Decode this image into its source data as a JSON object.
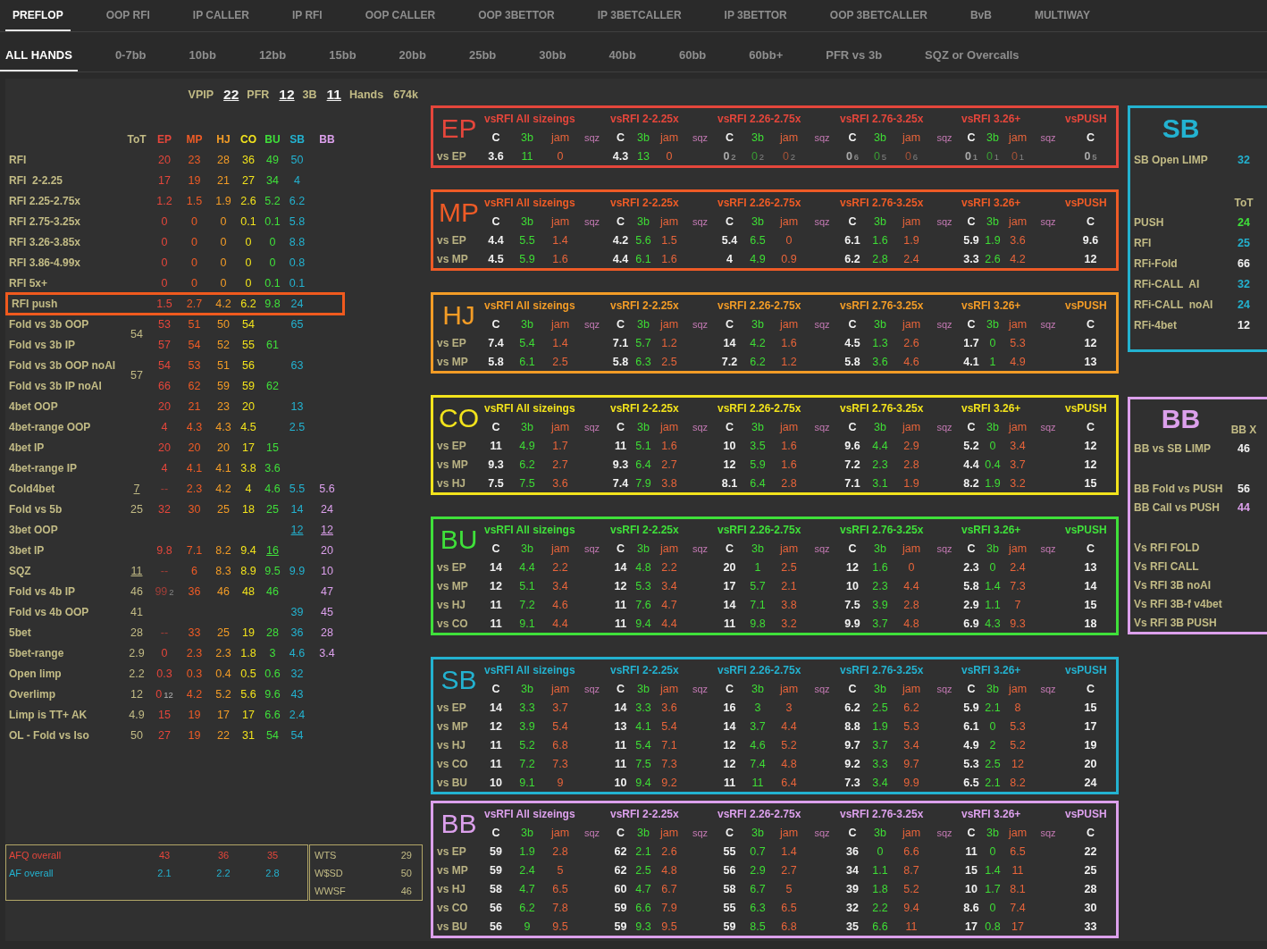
{
  "tabs": [
    {
      "label": "PREFLOP",
      "selected": true
    },
    {
      "label": "OOP RFI",
      "selected": false
    },
    {
      "label": "IP CALLER",
      "selected": false
    },
    {
      "label": "IP RFI",
      "selected": false
    },
    {
      "label": "OOP CALLER",
      "selected": false
    },
    {
      "label": "OOP 3BETTOR",
      "selected": false
    },
    {
      "label": "IP 3BETCALLER",
      "selected": false
    },
    {
      "label": "IP 3BETTOR",
      "selected": false
    },
    {
      "label": "OOP 3BETCALLER",
      "selected": false
    },
    {
      "label": "BvB",
      "selected": false
    },
    {
      "label": "MULTIWAY",
      "selected": false
    }
  ],
  "subtabs": [
    {
      "label": "ALL HANDS",
      "selected": true
    },
    {
      "label": "0-7bb",
      "selected": false
    },
    {
      "label": "10bb",
      "selected": false
    },
    {
      "label": "12bb",
      "selected": false
    },
    {
      "label": "15bb",
      "selected": false
    },
    {
      "label": "20bb",
      "selected": false
    },
    {
      "label": "25bb",
      "selected": false
    },
    {
      "label": "30bb",
      "selected": false
    },
    {
      "label": "40bb",
      "selected": false
    },
    {
      "label": "60bb",
      "selected": false
    },
    {
      "label": "60bb+",
      "selected": false
    },
    {
      "label": "PFR vs 3b",
      "selected": false
    },
    {
      "label": "SQZ or Overcalls",
      "selected": false
    }
  ],
  "summary": [
    {
      "label": "VPIP",
      "value": "22",
      "underlined": true
    },
    {
      "label": "PFR",
      "value": "12",
      "underlined": true
    },
    {
      "label": "3B",
      "value": "11",
      "underlined": true
    },
    {
      "label": "Hands",
      "value": "674k",
      "underlined": false
    }
  ],
  "position_table": {
    "columns": [
      {
        "label": "ToT",
        "color": "#c2bb85"
      },
      {
        "label": "EP",
        "color": "#e5463b"
      },
      {
        "label": "MP",
        "color": "#ee5b26"
      },
      {
        "label": "HJ",
        "color": "#f39c26"
      },
      {
        "label": "CO",
        "color": "#f2e31c"
      },
      {
        "label": "BU",
        "color": "#3fe03a"
      },
      {
        "label": "SB",
        "color": "#23b2d0"
      },
      {
        "label": "BB",
        "color": "#dca0ec"
      }
    ],
    "rows": [
      {
        "label": "RFI",
        "highlighted": false,
        "cells": [
          null,
          "20",
          "23",
          "28",
          "36",
          "49",
          "50",
          null
        ]
      },
      {
        "label": "RFI  2-2.25",
        "highlighted": false,
        "cells": [
          null,
          "17",
          "19",
          "21",
          "27",
          "34",
          "4",
          null
        ]
      },
      {
        "label": "RFI 2.25-2.75x",
        "highlighted": false,
        "cells": [
          null,
          "1.2",
          "1.5",
          "1.9",
          "2.6",
          "5.2",
          "6.2",
          null
        ]
      },
      {
        "label": "RFI 2.75-3.25x",
        "highlighted": false,
        "cells": [
          null,
          "0",
          "0",
          "0",
          "0.1",
          "0.1",
          "5.8",
          null
        ]
      },
      {
        "label": "RFI 3.26-3.85x",
        "highlighted": false,
        "cells": [
          null,
          "0",
          "0",
          "0",
          "0",
          "0",
          "8.8",
          null
        ]
      },
      {
        "label": "RFI 3.86-4.99x",
        "highlighted": false,
        "cells": [
          null,
          "0",
          "0",
          "0",
          "0",
          "0",
          "0.8",
          null
        ]
      },
      {
        "label": "RFI 5x+",
        "highlighted": false,
        "cells": [
          null,
          "0",
          "0",
          "0",
          "0",
          "0.1",
          "0.1",
          null
        ]
      },
      {
        "label": "RFI push",
        "highlighted": true,
        "cells": [
          null,
          "1.5",
          "2.7",
          "4.2",
          "6.2",
          "9.8",
          "24",
          null
        ]
      },
      {
        "label": "Fold vs 3b OOP",
        "highlighted": false,
        "cells": [
          {
            "value": "54",
            "spans_next_row": true
          },
          "53",
          "51",
          "50",
          "54",
          null,
          "65",
          null
        ]
      },
      {
        "label": "Fold vs 3b IP",
        "highlighted": false,
        "cells": [
          null,
          "57",
          "54",
          "52",
          "55",
          "61",
          null,
          null
        ]
      },
      {
        "label": "Fold vs 3b OOP noAI",
        "highlighted": false,
        "cells": [
          {
            "value": "57",
            "spans_next_row": true
          },
          "54",
          "53",
          "51",
          "56",
          null,
          "63",
          null
        ]
      },
      {
        "label": "Fold vs 3b IP noAI",
        "highlighted": false,
        "cells": [
          null,
          "66",
          "62",
          "59",
          "59",
          "62",
          null,
          null
        ]
      },
      {
        "label": "4bet OOP",
        "highlighted": false,
        "cells": [
          null,
          "20",
          "21",
          "23",
          "20",
          null,
          "13",
          null
        ]
      },
      {
        "label": "4bet-range OOP",
        "highlighted": false,
        "cells": [
          null,
          "4",
          "4.3",
          "4.3",
          "4.5",
          null,
          "2.5",
          null
        ]
      },
      {
        "label": "4bet IP",
        "highlighted": false,
        "cells": [
          null,
          "20",
          "20",
          "20",
          "17",
          "15",
          null,
          null
        ]
      },
      {
        "label": "4bet-range IP",
        "highlighted": false,
        "cells": [
          null,
          "4",
          "4.1",
          "4.1",
          "3.8",
          "3.6",
          null,
          null
        ]
      },
      {
        "label": "Cold4bet",
        "highlighted": false,
        "cells": [
          {
            "value": "7",
            "underlined": true
          },
          {
            "value": "--",
            "dim": true
          },
          "2.3",
          "4.2",
          "4",
          "4.6",
          "5.5",
          "5.6"
        ]
      },
      {
        "label": "Fold vs 5b",
        "highlighted": false,
        "cells": [
          "25",
          "32",
          "30",
          "25",
          "18",
          "25",
          "14",
          "24"
        ]
      },
      {
        "label": "3bet OOP",
        "highlighted": false,
        "cells": [
          null,
          null,
          null,
          null,
          null,
          null,
          {
            "value": "12",
            "underlined": true
          },
          {
            "value": "12",
            "underlined": true
          }
        ]
      },
      {
        "label": "3bet IP",
        "highlighted": false,
        "cells": [
          null,
          "9.8",
          "7.1",
          "8.2",
          "9.4",
          {
            "value": "16",
            "underlined": true
          },
          null,
          "20"
        ]
      },
      {
        "label": "SQZ",
        "highlighted": false,
        "cells": [
          {
            "value": "11",
            "underlined": true
          },
          {
            "value": "--",
            "dim": true
          },
          "6",
          "8.3",
          "8.9",
          "9.5",
          "9.9",
          "10"
        ]
      },
      {
        "label": "Fold vs 4b IP",
        "highlighted": false,
        "cells": [
          "46",
          {
            "value": "99",
            "sample": "2",
            "dim": true
          },
          "36",
          "46",
          "48",
          "46",
          null,
          "47"
        ]
      },
      {
        "label": "Fold vs 4b OOP",
        "highlighted": false,
        "cells": [
          "41",
          null,
          null,
          null,
          null,
          null,
          "39",
          "45"
        ]
      },
      {
        "label": "5bet",
        "highlighted": false,
        "cells": [
          "28",
          {
            "value": "--",
            "dim": true
          },
          "33",
          "25",
          "19",
          "28",
          "36",
          "28"
        ]
      },
      {
        "label": "5bet-range",
        "highlighted": false,
        "cells": [
          "2.9",
          "0",
          "2.3",
          "2.3",
          "1.8",
          "3",
          "4.6",
          "3.4"
        ]
      },
      {
        "label": "Open limp",
        "highlighted": false,
        "cells": [
          "2.2",
          "0.3",
          "0.3",
          "0.4",
          "0.5",
          "0.6",
          "32",
          null
        ]
      },
      {
        "label": "Overlimp",
        "highlighted": false,
        "cells": [
          "12",
          {
            "value": "0",
            "sample": "12"
          },
          "4.2",
          "5.2",
          "5.6",
          "9.6",
          "43",
          null
        ]
      },
      {
        "label": "Limp is TT+ AK",
        "highlighted": false,
        "cells": [
          "4.9",
          "15",
          "19",
          "17",
          "17",
          "6.6",
          "2.4",
          null
        ]
      },
      {
        "label": "OL - Fold vs Iso",
        "highlighted": false,
        "cells": [
          "50",
          "27",
          "19",
          "22",
          "31",
          "54",
          "54",
          null
        ]
      }
    ]
  },
  "aggression": [
    {
      "label": "AFQ overall",
      "color": "#e5463b",
      "values": [
        "43",
        "36",
        "35"
      ]
    },
    {
      "label": "AF overall",
      "color": "#23b2d0",
      "values": [
        "2.1",
        "2.2",
        "2.8"
      ]
    }
  ],
  "showdown": [
    {
      "label": "WTS",
      "value": "29"
    },
    {
      "label": "W$SD",
      "value": "50"
    },
    {
      "label": "WWSF",
      "value": "46"
    }
  ],
  "position_panels": [
    {
      "title": "EP",
      "color": "#e5463b",
      "groups": [
        {
          "heading": "vsRFI All sizeings",
          "columns": [
            "C",
            "3b",
            "jam",
            "sqz"
          ]
        },
        {
          "heading": "vsRFI 2-2.25x",
          "columns": [
            "C",
            "3b",
            "jam",
            "sqz"
          ]
        },
        {
          "heading": "vsRFI 2.26-2.75x",
          "columns": [
            "C",
            "3b",
            "jam",
            "sqz"
          ]
        },
        {
          "heading": "vsRFI 2.76-3.25x",
          "columns": [
            "C",
            "3b",
            "jam",
            "sqz"
          ]
        },
        {
          "heading": "vsRFI 3.26+",
          "columns": [
            "C",
            "3b",
            "jam",
            "sqz"
          ]
        },
        {
          "heading": "vsPUSH",
          "columns": [
            "C"
          ]
        }
      ],
      "rows": [
        {
          "label": "vs EP",
          "cells": [
            [
              "3.6",
              "11",
              "0"
            ],
            [
              "4.3",
              "13",
              "0"
            ],
            [
              {
                "value": "0",
                "sample": "2",
                "dim": true
              },
              {
                "value": "0",
                "sample": "2",
                "dim": true
              },
              {
                "value": "0",
                "sample": "2",
                "dim": true
              }
            ],
            [
              {
                "value": "0",
                "sample": "6",
                "dim": true
              },
              {
                "value": "0",
                "sample": "5",
                "dim": true
              },
              {
                "value": "0",
                "sample": "6",
                "dim": true
              }
            ],
            [
              {
                "value": "0",
                "sample": "1",
                "dim": true
              },
              {
                "value": "0",
                "sample": "1",
                "dim": true
              },
              {
                "value": "0",
                "sample": "1",
                "dim": true
              }
            ],
            [
              {
                "value": "0",
                "sample": "5",
                "dim": true
              }
            ]
          ]
        }
      ]
    },
    {
      "title": "MP",
      "color": "#ee5b26",
      "groups": [
        {
          "heading": "vsRFI All sizeings",
          "columns": [
            "C",
            "3b",
            "jam",
            "sqz"
          ]
        },
        {
          "heading": "vsRFI 2-2.25x",
          "columns": [
            "C",
            "3b",
            "jam",
            "sqz"
          ]
        },
        {
          "heading": "vsRFI 2.26-2.75x",
          "columns": [
            "C",
            "3b",
            "jam",
            "sqz"
          ]
        },
        {
          "heading": "vsRFI 2.76-3.25x",
          "columns": [
            "C",
            "3b",
            "jam",
            "sqz"
          ]
        },
        {
          "heading": "vsRFI 3.26+",
          "columns": [
            "C",
            "3b",
            "jam",
            "sqz"
          ]
        },
        {
          "heading": "vsPUSH",
          "columns": [
            "C"
          ]
        }
      ],
      "rows": [
        {
          "label": "vs EP",
          "cells": [
            [
              "4.4",
              "5.5",
              "1.4"
            ],
            [
              "4.2",
              "5.6",
              "1.5"
            ],
            [
              "5.4",
              "6.5",
              "0"
            ],
            [
              "6.1",
              "1.6",
              "1.9"
            ],
            [
              "5.9",
              "1.9",
              "3.6"
            ],
            [
              "9.6"
            ]
          ]
        },
        {
          "label": "vs MP",
          "cells": [
            [
              "4.5",
              "5.9",
              "1.6"
            ],
            [
              "4.4",
              "6.1",
              "1.6"
            ],
            [
              "4",
              "4.9",
              "0.9"
            ],
            [
              "6.2",
              "2.8",
              "2.4"
            ],
            [
              "3.3",
              "2.6",
              "4.2"
            ],
            [
              "12"
            ]
          ]
        }
      ]
    },
    {
      "title": "HJ",
      "color": "#f39c26",
      "groups": [
        {
          "heading": "vsRFI All sizeings",
          "columns": [
            "C",
            "3b",
            "jam",
            "sqz"
          ]
        },
        {
          "heading": "vsRFI 2-2.25x",
          "columns": [
            "C",
            "3b",
            "jam",
            "sqz"
          ]
        },
        {
          "heading": "vsRFI 2.26-2.75x",
          "columns": [
            "C",
            "3b",
            "jam",
            "sqz"
          ]
        },
        {
          "heading": "vsRFI 2.76-3.25x",
          "columns": [
            "C",
            "3b",
            "jam",
            "sqz"
          ]
        },
        {
          "heading": "vsRFI 3.26+",
          "columns": [
            "C",
            "3b",
            "jam",
            "sqz"
          ]
        },
        {
          "heading": "vsPUSH",
          "columns": [
            "C"
          ]
        }
      ],
      "rows": [
        {
          "label": "vs EP",
          "cells": [
            [
              "7.4",
              "5.4",
              "1.4"
            ],
            [
              "7.1",
              "5.7",
              "1.2"
            ],
            [
              "14",
              "4.2",
              "1.6"
            ],
            [
              "4.5",
              "1.3",
              "2.6"
            ],
            [
              "1.7",
              "0",
              "5.3"
            ],
            [
              "12"
            ]
          ]
        },
        {
          "label": "vs MP",
          "cells": [
            [
              "5.8",
              "6.1",
              "2.5"
            ],
            [
              "5.8",
              "6.3",
              "2.5"
            ],
            [
              "7.2",
              "6.2",
              "1.2"
            ],
            [
              "5.8",
              "3.6",
              "4.6"
            ],
            [
              "4.1",
              "1",
              "4.9"
            ],
            [
              "13"
            ]
          ]
        }
      ]
    },
    {
      "title": "CO",
      "color": "#f2e31c",
      "groups": [
        {
          "heading": "vsRFI All sizeings",
          "columns": [
            "C",
            "3b",
            "jam",
            "sqz"
          ]
        },
        {
          "heading": "vsRFI 2-2.25x",
          "columns": [
            "C",
            "3b",
            "jam",
            "sqz"
          ]
        },
        {
          "heading": "vsRFI 2.26-2.75x",
          "columns": [
            "C",
            "3b",
            "jam",
            "sqz"
          ]
        },
        {
          "heading": "vsRFI 2.76-3.25x",
          "columns": [
            "C",
            "3b",
            "jam",
            "sqz"
          ]
        },
        {
          "heading": "vsRFI 3.26+",
          "columns": [
            "C",
            "3b",
            "jam",
            "sqz"
          ]
        },
        {
          "heading": "vsPUSH",
          "columns": [
            "C"
          ]
        }
      ],
      "rows": [
        {
          "label": "vs EP",
          "cells": [
            [
              "11",
              "4.9",
              "1.7"
            ],
            [
              "11",
              "5.1",
              "1.6"
            ],
            [
              "10",
              "3.5",
              "1.6"
            ],
            [
              "9.6",
              "4.4",
              "2.9"
            ],
            [
              "5.2",
              "0",
              "3.4"
            ],
            [
              "12"
            ]
          ]
        },
        {
          "label": "vs MP",
          "cells": [
            [
              "9.3",
              "6.2",
              "2.7"
            ],
            [
              "9.3",
              "6.4",
              "2.7"
            ],
            [
              "12",
              "5.9",
              "1.6"
            ],
            [
              "7.2",
              "2.3",
              "2.8"
            ],
            [
              "4.4",
              "0.4",
              "3.7"
            ],
            [
              "12"
            ]
          ]
        },
        {
          "label": "vs HJ",
          "cells": [
            [
              "7.5",
              "7.5",
              "3.6"
            ],
            [
              "7.4",
              "7.9",
              "3.8"
            ],
            [
              "8.1",
              "6.4",
              "2.8"
            ],
            [
              "7.1",
              "3.1",
              "1.9"
            ],
            [
              "8.2",
              "1.9",
              "3.2"
            ],
            [
              "15"
            ]
          ]
        }
      ]
    },
    {
      "title": "BU",
      "color": "#3fe03a",
      "groups": [
        {
          "heading": "vsRFI All sizeings",
          "columns": [
            "C",
            "3b",
            "jam",
            "sqz"
          ]
        },
        {
          "heading": "vsRFI 2-2.25x",
          "columns": [
            "C",
            "3b",
            "jam",
            "sqz"
          ]
        },
        {
          "heading": "vsRFI 2.26-2.75x",
          "columns": [
            "C",
            "3b",
            "jam",
            "sqz"
          ]
        },
        {
          "heading": "vsRFI 2.76-3.25x",
          "columns": [
            "C",
            "3b",
            "jam",
            "sqz"
          ]
        },
        {
          "heading": "vsRFI 3.26+",
          "columns": [
            "C",
            "3b",
            "jam",
            "sqz"
          ]
        },
        {
          "heading": "vsPUSH",
          "columns": [
            "C"
          ]
        }
      ],
      "rows": [
        {
          "label": "vs EP",
          "cells": [
            [
              "14",
              "4.4",
              "2.2"
            ],
            [
              "14",
              "4.8",
              "2.2"
            ],
            [
              "20",
              "1",
              "2.5"
            ],
            [
              "12",
              "1.6",
              "0"
            ],
            [
              "2.3",
              "0",
              "2.4"
            ],
            [
              "13"
            ]
          ]
        },
        {
          "label": "vs MP",
          "cells": [
            [
              "12",
              "5.1",
              "3.4"
            ],
            [
              "12",
              "5.3",
              "3.4"
            ],
            [
              "17",
              "5.7",
              "2.1"
            ],
            [
              "10",
              "2.3",
              "4.4"
            ],
            [
              "5.8",
              "1.4",
              "7.3"
            ],
            [
              "14"
            ]
          ]
        },
        {
          "label": "vs HJ",
          "cells": [
            [
              "11",
              "7.2",
              "4.6"
            ],
            [
              "11",
              "7.6",
              "4.7"
            ],
            [
              "14",
              "7.1",
              "3.8"
            ],
            [
              "7.5",
              "3.9",
              "2.8"
            ],
            [
              "2.9",
              "1.1",
              "7"
            ],
            [
              "15"
            ]
          ]
        },
        {
          "label": "vs CO",
          "cells": [
            [
              "11",
              "9.1",
              "4.4"
            ],
            [
              "11",
              "9.4",
              "4.4"
            ],
            [
              "11",
              "9.8",
              "3.2"
            ],
            [
              "9.9",
              "3.7",
              "4.8"
            ],
            [
              "6.9",
              "4.3",
              "9.3"
            ],
            [
              "18"
            ]
          ]
        }
      ]
    },
    {
      "title": "SB",
      "color": "#23b2d0",
      "groups": [
        {
          "heading": "vsRFI All sizeings",
          "columns": [
            "C",
            "3b",
            "jam",
            "sqz"
          ]
        },
        {
          "heading": "vsRFI 2-2.25x",
          "columns": [
            "C",
            "3b",
            "jam",
            "sqz"
          ]
        },
        {
          "heading": "vsRFI 2.26-2.75x",
          "columns": [
            "C",
            "3b",
            "jam",
            "sqz"
          ]
        },
        {
          "heading": "vsRFI 2.76-3.25x",
          "columns": [
            "C",
            "3b",
            "jam",
            "sqz"
          ]
        },
        {
          "heading": "vsRFI 3.26+",
          "columns": [
            "C",
            "3b",
            "jam",
            "sqz"
          ]
        },
        {
          "heading": "vsPUSH",
          "columns": [
            "C"
          ]
        }
      ],
      "rows": [
        {
          "label": "vs EP",
          "cells": [
            [
              "14",
              "3.3",
              "3.7"
            ],
            [
              "14",
              "3.3",
              "3.6"
            ],
            [
              "16",
              "3",
              "3"
            ],
            [
              "6.2",
              "2.5",
              "6.2"
            ],
            [
              "5.9",
              "2.1",
              "8"
            ],
            [
              "15"
            ]
          ]
        },
        {
          "label": "vs MP",
          "cells": [
            [
              "12",
              "3.9",
              "5.4"
            ],
            [
              "13",
              "4.1",
              "5.4"
            ],
            [
              "14",
              "3.7",
              "4.4"
            ],
            [
              "8.8",
              "1.9",
              "5.3"
            ],
            [
              "6.1",
              "0",
              "5.3"
            ],
            [
              "17"
            ]
          ]
        },
        {
          "label": "vs HJ",
          "cells": [
            [
              "11",
              "5.2",
              "6.8"
            ],
            [
              "11",
              "5.4",
              "7.1"
            ],
            [
              "12",
              "4.6",
              "5.2"
            ],
            [
              "9.7",
              "3.7",
              "3.4"
            ],
            [
              "4.9",
              "2",
              "5.2"
            ],
            [
              "19"
            ]
          ]
        },
        {
          "label": "vs CO",
          "cells": [
            [
              "11",
              "7.2",
              "7.3"
            ],
            [
              "11",
              "7.5",
              "7.3"
            ],
            [
              "12",
              "7.4",
              "4.8"
            ],
            [
              "9.2",
              "3.3",
              "9.7"
            ],
            [
              "5.3",
              "2.5",
              "12"
            ],
            [
              "20"
            ]
          ]
        },
        {
          "label": "vs BU",
          "cells": [
            [
              "10",
              "9.1",
              "9"
            ],
            [
              "10",
              "9.4",
              "9.2"
            ],
            [
              "11",
              "11",
              "6.4"
            ],
            [
              "7.3",
              "3.4",
              "9.9"
            ],
            [
              "6.5",
              "2.1",
              "8.2"
            ],
            [
              "24"
            ]
          ]
        }
      ]
    },
    {
      "title": "BB",
      "color": "#dca0ec",
      "groups": [
        {
          "heading": "vsRFI All sizeings",
          "columns": [
            "C",
            "3b",
            "jam",
            "sqz"
          ]
        },
        {
          "heading": "vsRFI 2-2.25x",
          "columns": [
            "C",
            "3b",
            "jam",
            "sqz"
          ]
        },
        {
          "heading": "vsRFI 2.26-2.75x",
          "columns": [
            "C",
            "3b",
            "jam",
            "sqz"
          ]
        },
        {
          "heading": "vsRFI 2.76-3.25x",
          "columns": [
            "C",
            "3b",
            "jam",
            "sqz"
          ]
        },
        {
          "heading": "vsRFI 3.26+",
          "columns": [
            "C",
            "3b",
            "jam",
            "sqz"
          ]
        },
        {
          "heading": "vsPUSH",
          "columns": [
            "C"
          ]
        }
      ],
      "rows": [
        {
          "label": "vs EP",
          "cells": [
            [
              "59",
              "1.9",
              "2.8"
            ],
            [
              "62",
              "2.1",
              "2.6"
            ],
            [
              "55",
              "0.7",
              "1.4"
            ],
            [
              "36",
              "0",
              "6.6"
            ],
            [
              "11",
              "0",
              "6.5"
            ],
            [
              "22"
            ]
          ]
        },
        {
          "label": "vs MP",
          "cells": [
            [
              "59",
              "2.4",
              "5"
            ],
            [
              "62",
              "2.5",
              "4.8"
            ],
            [
              "56",
              "2.9",
              "2.7"
            ],
            [
              "34",
              "1.1",
              "8.7"
            ],
            [
              "15",
              "1.4",
              "11"
            ],
            [
              "25"
            ]
          ]
        },
        {
          "label": "vs HJ",
          "cells": [
            [
              "58",
              "4.7",
              "6.5"
            ],
            [
              "60",
              "4.7",
              "6.7"
            ],
            [
              "58",
              "6.7",
              "5"
            ],
            [
              "39",
              "1.8",
              "5.2"
            ],
            [
              "10",
              "1.7",
              "8.1"
            ],
            [
              "28"
            ]
          ]
        },
        {
          "label": "vs CO",
          "cells": [
            [
              "56",
              "6.2",
              "7.8"
            ],
            [
              "59",
              "6.6",
              "7.9"
            ],
            [
              "55",
              "6.3",
              "6.5"
            ],
            [
              "32",
              "2.2",
              "9.4"
            ],
            [
              "8.6",
              "0",
              "7.4"
            ],
            [
              "30"
            ]
          ]
        },
        {
          "label": "vs BU",
          "cells": [
            [
              "56",
              "9",
              "9.5"
            ],
            [
              "59",
              "9.3",
              "9.5"
            ],
            [
              "59",
              "8.5",
              "6.8"
            ],
            [
              "35",
              "6.6",
              "11"
            ],
            [
              "17",
              "0.8",
              "17"
            ],
            [
              "33"
            ]
          ]
        }
      ]
    }
  ],
  "side_panels": [
    {
      "title": "SB",
      "color": "#23b2d0",
      "groups": [
        {
          "rows": [
            {
              "label": "SB Open LIMP",
              "value": "32",
              "color": "#23b2d0"
            }
          ]
        },
        {
          "heading": "ToT",
          "rows": [
            {
              "label": "PUSH",
              "value": "24",
              "color": "#3fe03a"
            },
            {
              "label": "RFI",
              "value": "25",
              "color": "#23b2d0"
            },
            {
              "label": "RFi-Fold",
              "value": "66",
              "color": "#f2f2f2"
            },
            {
              "label": "RFi-CALL  AI",
              "value": "32",
              "color": "#23b2d0"
            },
            {
              "label": "RFi-CALL  noAI",
              "value": "24",
              "color": "#23b2d0"
            },
            {
              "label": "RFi-4bet",
              "value": "12",
              "color": "#f2f2f2"
            }
          ]
        }
      ]
    },
    {
      "title": "BB",
      "color": "#dca0ec",
      "heading": "BB X",
      "groups": [
        {
          "rows": [
            {
              "label": "BB vs SB LIMP",
              "value": "46",
              "color": "#f2f2f2"
            }
          ]
        },
        {
          "rows": [
            {
              "label": "BB Fold vs PUSH",
              "value": "56",
              "color": "#f2f2f2"
            },
            {
              "label": "BB Call vs PUSH",
              "value": "44",
              "color": "#dca0ec"
            }
          ]
        },
        {
          "rows": [
            {
              "label": "Vs RFI FOLD"
            },
            {
              "label": "Vs RFI CALL"
            },
            {
              "label": "Vs RFI 3B noAI"
            },
            {
              "label": "Vs RFI 3B-f v4bet"
            },
            {
              "label": "Vs RFI 3B PUSH"
            }
          ]
        }
      ]
    }
  ]
}
